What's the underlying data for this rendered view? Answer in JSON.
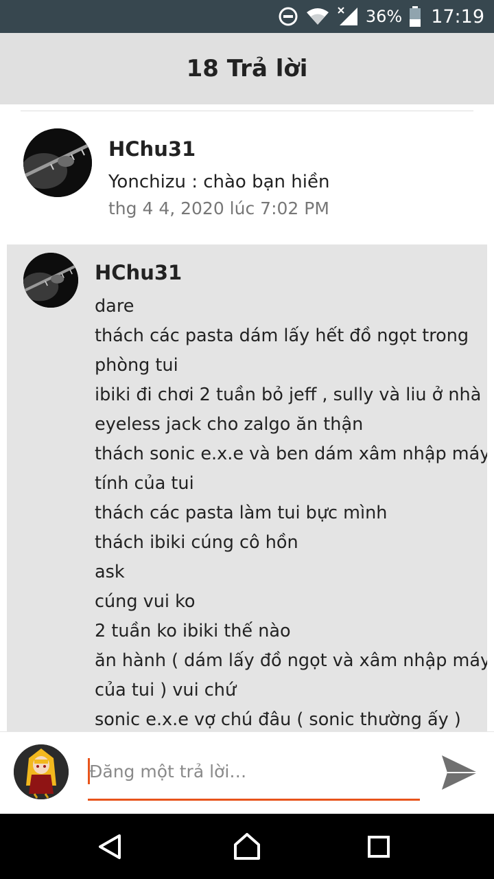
{
  "status_bar": {
    "battery": "36%",
    "time": "17:19",
    "icons": [
      "do-not-disturb-icon",
      "wifi-icon",
      "signal-icon",
      "battery-icon"
    ]
  },
  "header": {
    "title": "18 Trả lời"
  },
  "comments": [
    {
      "author": "HChu31",
      "text": "Yonchizu : chào bạn hiền",
      "time": "thg 4 4, 2020 lúc 7:02 PM"
    },
    {
      "author": "HChu31",
      "lines": [
        "dare",
        "thách các pasta dám lấy hết đồ ngọt trong",
        "phòng tui",
        "ibiki  đi chơi 2 tuần bỏ jeff , sully và liu ở nhà",
        "eyeless jack cho zalgo ăn thận",
        "thách sonic e.x.e và ben dám xâm nhập máy",
        "tính của tui",
        "thách các pasta làm tui bực mình",
        "thách ibiki cúng cô hồn",
        "ask",
        "cúng vui ko",
        "2 tuần ko ibiki thế nào",
        "ăn hành ( dám lấy đồ ngọt và xâm nhập máy",
        "của tui ) vui chứ",
        "sonic e.x.e vợ chú đâu ( sonic thường ấy )"
      ]
    }
  ],
  "reply": {
    "placeholder": "Đăng một trả lời…",
    "value": ""
  },
  "colors": {
    "accent": "#e8541b",
    "status_bar": "#37474f",
    "header_bg": "#e0e0e0",
    "highlight_bg": "#e4e4e4"
  },
  "nav": {
    "icons": [
      "back-icon",
      "home-icon",
      "recents-icon"
    ]
  }
}
